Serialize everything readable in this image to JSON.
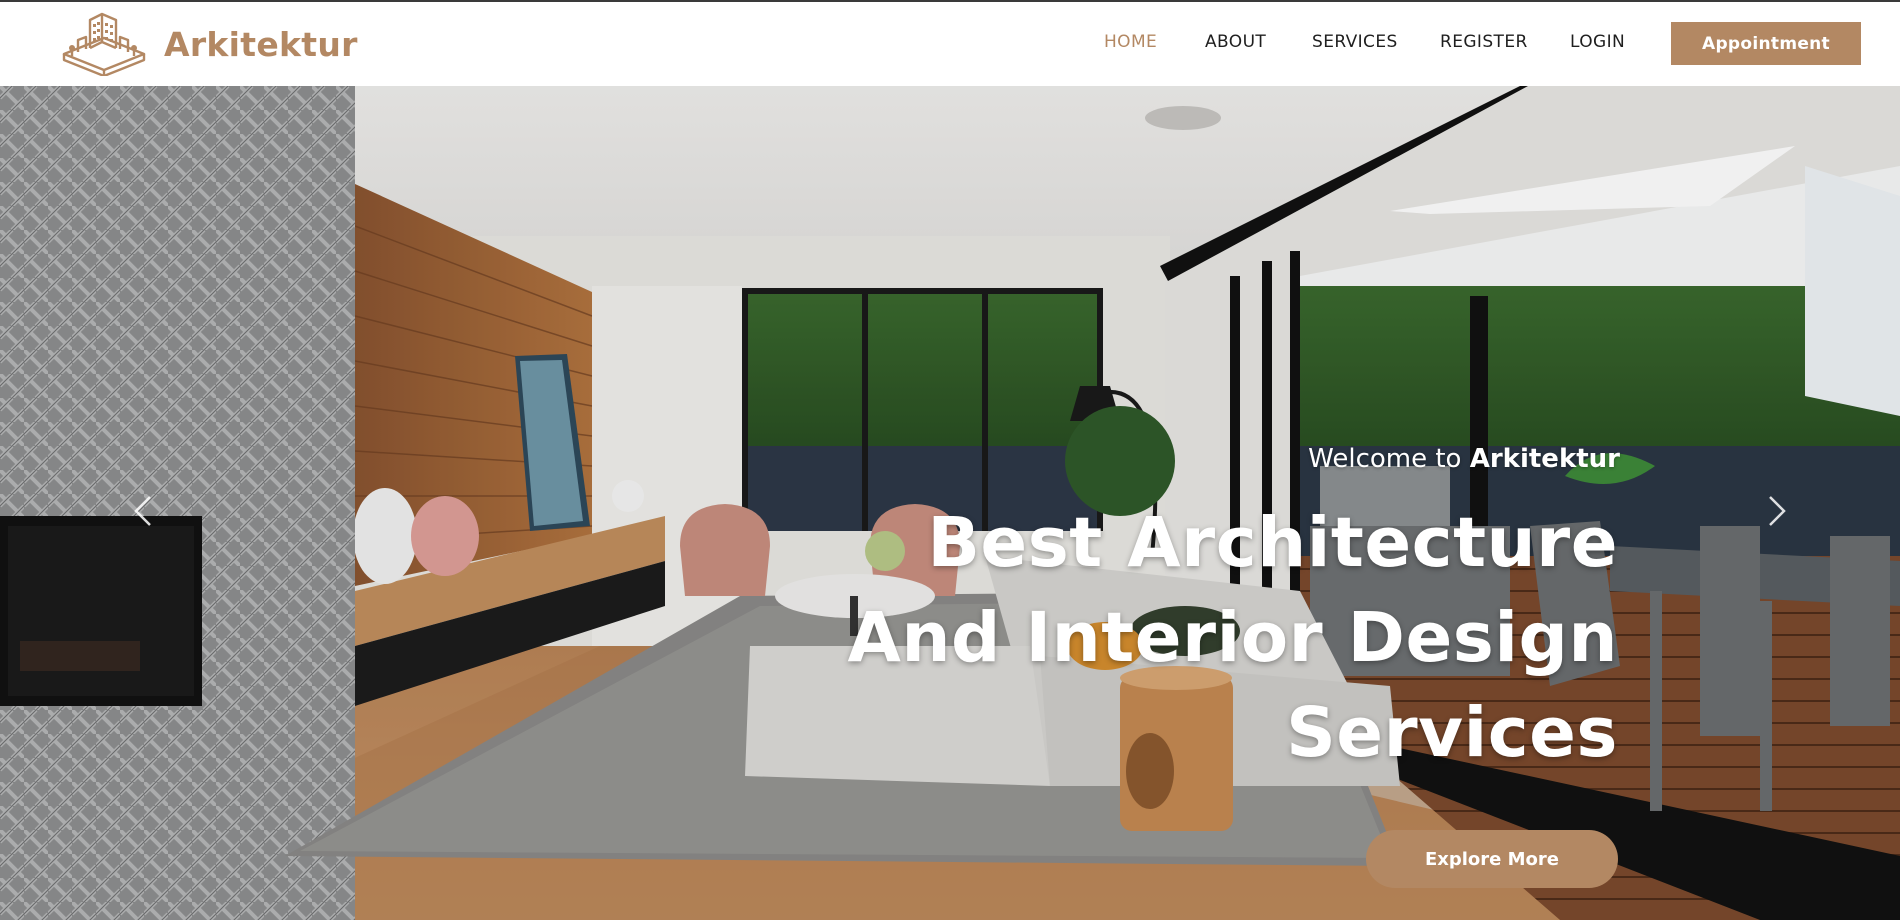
{
  "brand": {
    "name": "Arkitektur",
    "logo_icon": "building-logo-icon",
    "color": "#b38863"
  },
  "nav": {
    "items": [
      {
        "label": "HOME",
        "active": true
      },
      {
        "label": "ABOUT",
        "active": false
      },
      {
        "label": "SERVICES",
        "active": false
      },
      {
        "label": "REGISTER",
        "active": false
      },
      {
        "label": "LOGIN",
        "active": false
      }
    ],
    "cta_label": "Appointment"
  },
  "hero": {
    "welcome_prefix": "Welcome to",
    "welcome_brand": "Arkitektur",
    "headline_lines": [
      "Best Architecture",
      "And Interior Design",
      "Services"
    ],
    "button_label": "Explore More",
    "prev_icon": "chevron-left-icon",
    "next_icon": "chevron-right-icon"
  },
  "colors": {
    "accent": "#b38863",
    "nav_text": "#1f1f1f",
    "hero_text": "#ffffff"
  }
}
